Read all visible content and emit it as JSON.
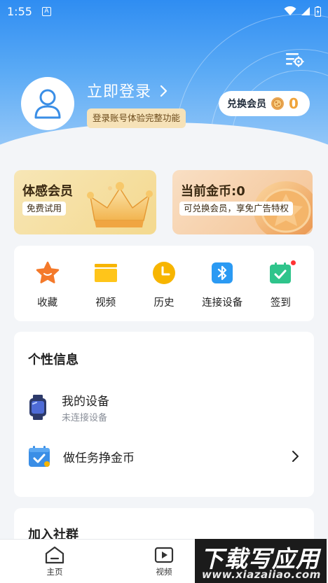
{
  "status_bar": {
    "time": "1:55",
    "notif_icon": "A"
  },
  "header": {
    "login_title": "立即登录",
    "login_subtitle": "登录账号体验完整功能",
    "redeem_label": "兑换会员",
    "coin_count": "0"
  },
  "promos": [
    {
      "title": "体感会员",
      "tag": "免费试用"
    },
    {
      "title": "当前金币:0",
      "tag": "可兑换会员，享免广告特权"
    }
  ],
  "quick_actions": [
    {
      "label": "收藏",
      "icon": "star-icon"
    },
    {
      "label": "视频",
      "icon": "video-folder-icon"
    },
    {
      "label": "历史",
      "icon": "clock-icon"
    },
    {
      "label": "连接设备",
      "icon": "bluetooth-icon"
    },
    {
      "label": "签到",
      "icon": "calendar-check-icon"
    }
  ],
  "personal_info": {
    "title": "个性信息",
    "device": {
      "title": "我的设备",
      "subtitle": "未连接设备"
    },
    "task": {
      "title": "做任务挣金币"
    }
  },
  "community": {
    "title": "加入社群"
  },
  "bottom_nav": [
    {
      "label": "主页",
      "icon": "home-icon"
    },
    {
      "label": "视频",
      "icon": "video-play-icon"
    }
  ],
  "watermark": {
    "main": "下载写应用",
    "url": "www.xiazaiiao.com"
  },
  "colors": {
    "header_blue": "#2f8df2",
    "gold": "#f0a43a",
    "accent_orange": "#f4792a",
    "bluetooth_blue": "#2b9af3",
    "green": "#2fc48b"
  }
}
